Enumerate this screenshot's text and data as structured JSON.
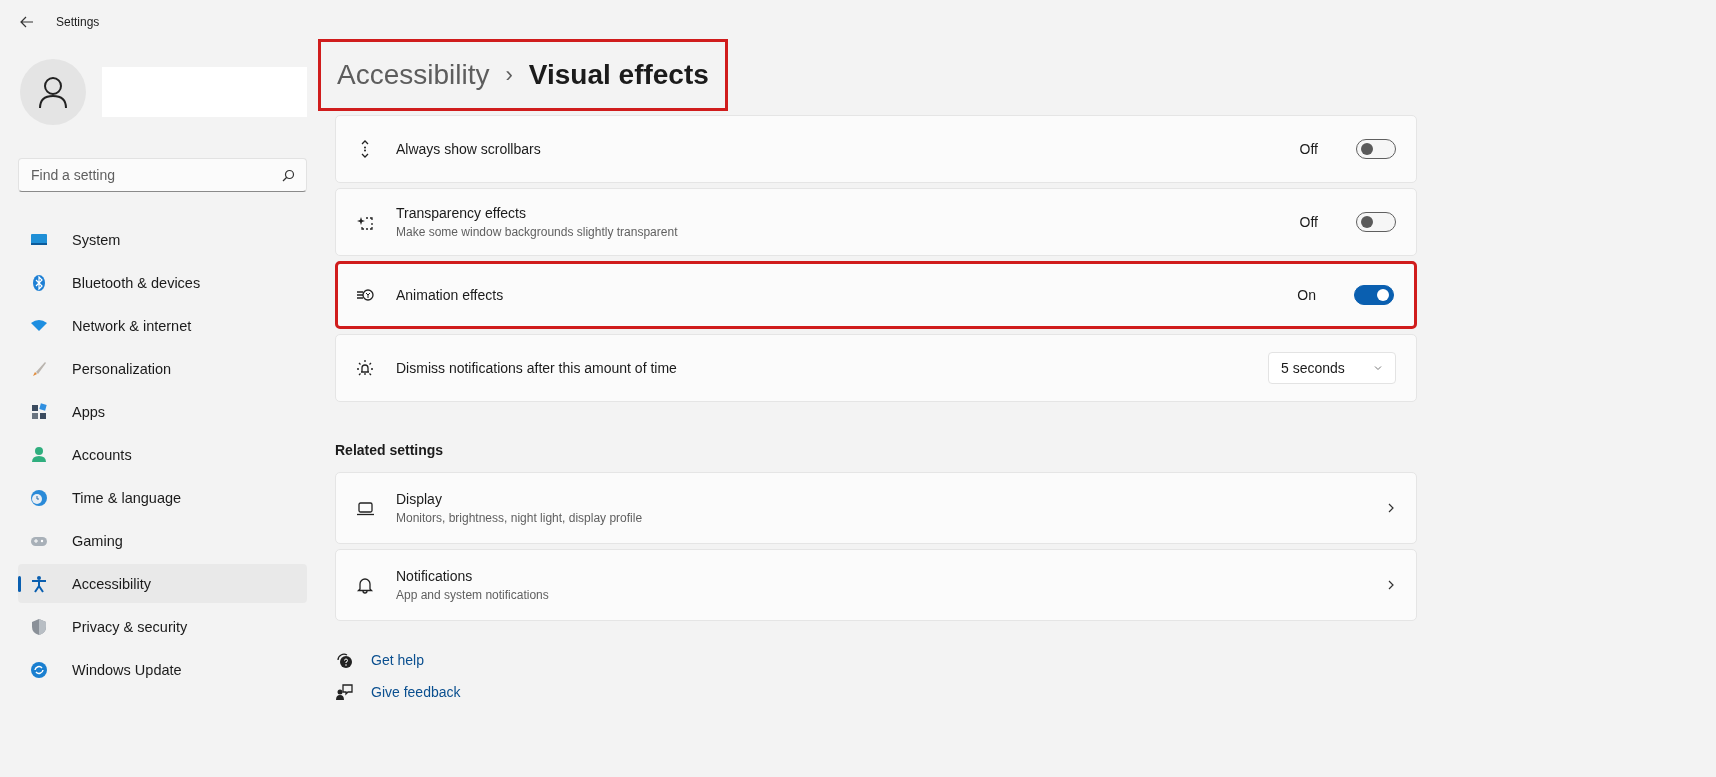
{
  "window": {
    "title": "Settings"
  },
  "sidebar": {
    "search": {
      "placeholder": "Find a setting"
    },
    "items": [
      {
        "label": "System",
        "selected": false
      },
      {
        "label": "Bluetooth & devices",
        "selected": false
      },
      {
        "label": "Network & internet",
        "selected": false
      },
      {
        "label": "Personalization",
        "selected": false
      },
      {
        "label": "Apps",
        "selected": false
      },
      {
        "label": "Accounts",
        "selected": false
      },
      {
        "label": "Time & language",
        "selected": false
      },
      {
        "label": "Gaming",
        "selected": false
      },
      {
        "label": "Accessibility",
        "selected": true
      },
      {
        "label": "Privacy & security",
        "selected": false
      },
      {
        "label": "Windows Update",
        "selected": false
      }
    ]
  },
  "breadcrumb": {
    "parent": "Accessibility",
    "separator": "›",
    "current": "Visual effects",
    "highlighted": true
  },
  "settings": [
    {
      "kind": "toggle",
      "title": "Always show scrollbars",
      "state_label": "Off",
      "on": false,
      "highlighted": false
    },
    {
      "kind": "toggle",
      "title": "Transparency effects",
      "subtitle": "Make some window backgrounds slightly transparent",
      "state_label": "Off",
      "on": false,
      "highlighted": false
    },
    {
      "kind": "toggle",
      "title": "Animation effects",
      "state_label": "On",
      "on": true,
      "highlighted": true
    },
    {
      "kind": "dropdown",
      "title": "Dismiss notifications after this amount of time",
      "value": "5 seconds",
      "highlighted": false
    }
  ],
  "related": {
    "heading": "Related settings",
    "items": [
      {
        "title": "Display",
        "subtitle": "Monitors, brightness, night light, display profile"
      },
      {
        "title": "Notifications",
        "subtitle": "App and system notifications"
      }
    ]
  },
  "links": [
    "Get help",
    "Give feedback"
  ]
}
